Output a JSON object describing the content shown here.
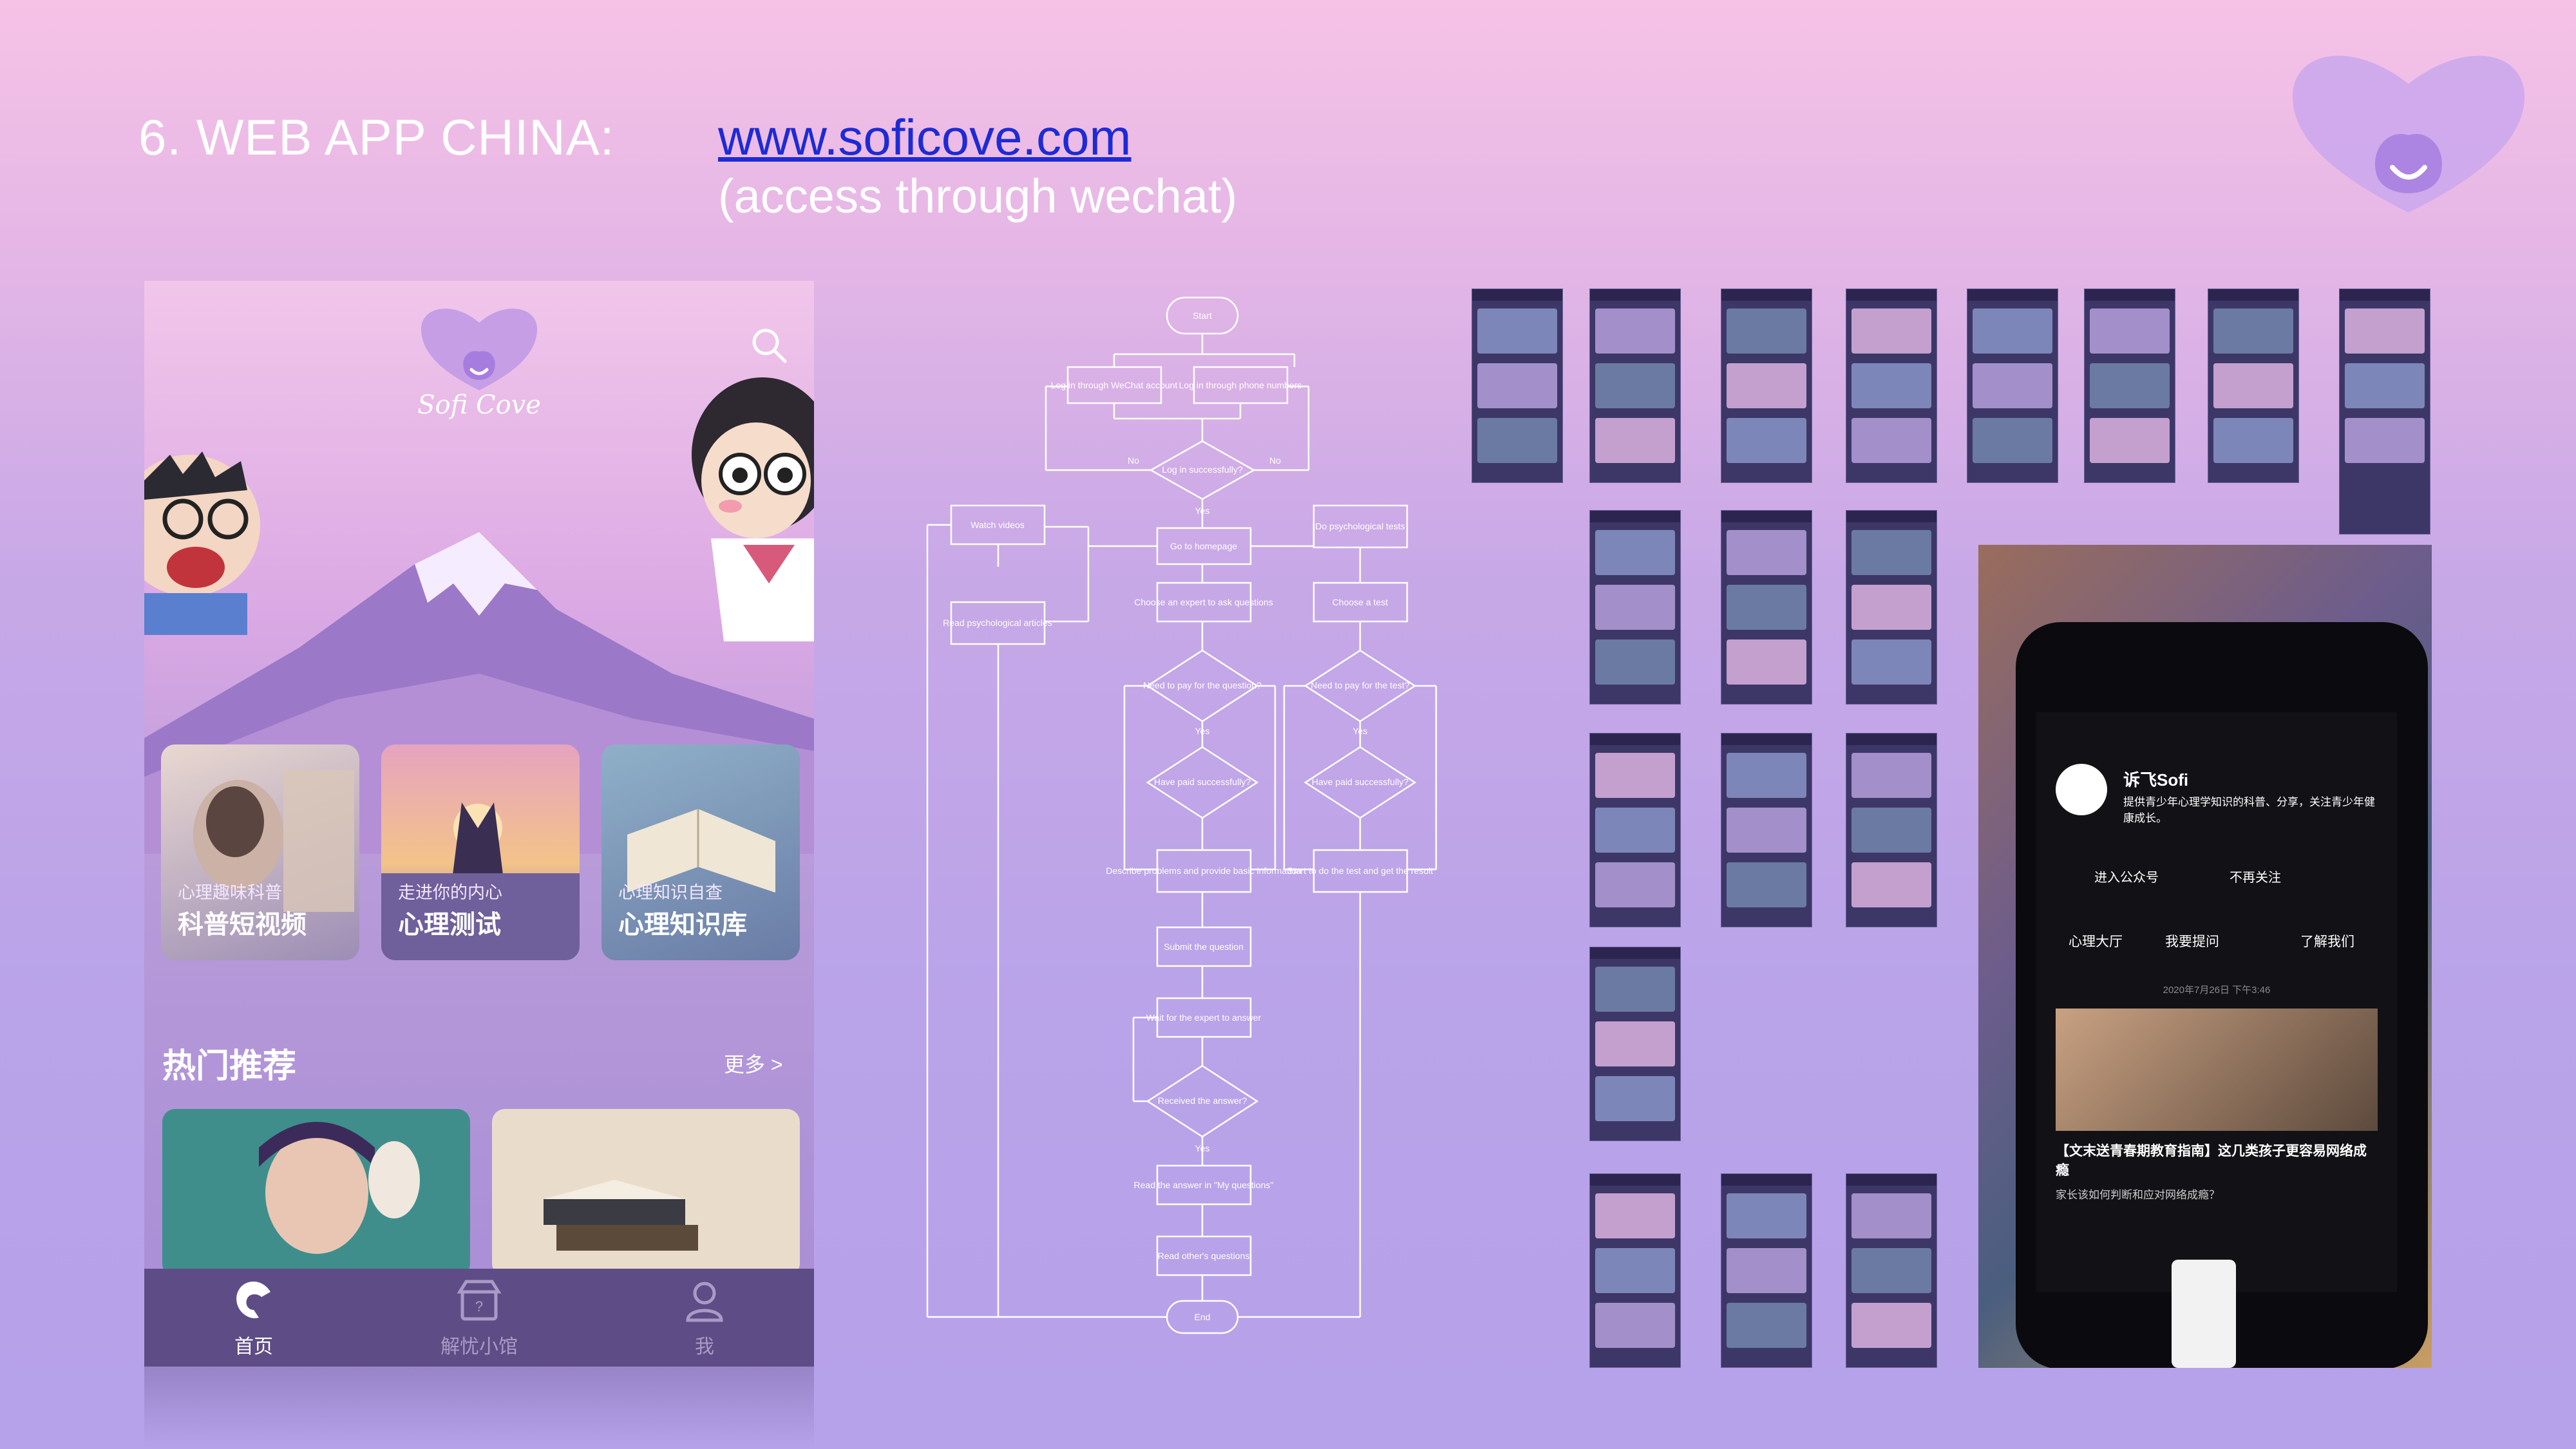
{
  "header": {
    "title": "6. WEB APP CHINA:",
    "url": "www.soficove.com",
    "subtitle": "(access through wechat)"
  },
  "phone": {
    "brand": "Sofi Cove",
    "cards": [
      {
        "subtitle": "心理趣味科普",
        "title": "科普短视频"
      },
      {
        "subtitle": "走进你的内心",
        "title": "心理测试"
      },
      {
        "subtitle": "心理知识自查",
        "title": "心理知识库"
      }
    ],
    "section_title": "热门推荐",
    "more_label": "更多 >",
    "tabs": [
      {
        "label": "首页",
        "icon": "home-icon",
        "active": true
      },
      {
        "label": "解忧小馆",
        "icon": "store-icon",
        "active": false
      },
      {
        "label": "我",
        "icon": "profile-icon",
        "active": false
      }
    ]
  },
  "flowchart": {
    "nodes": {
      "start": "Start",
      "login_wechat": "Log in through WeChat account",
      "login_phone": "Log in through phone numbers",
      "login_ok": "Log in successfully?",
      "watch_videos": "Watch videos",
      "homepage": "Go to homepage",
      "psych_tests": "Do psychological tests",
      "read_articles": "Read psychological articles",
      "choose_expert": "Choose an expert to ask questions",
      "choose_test": "Choose a test",
      "pay_question": "Need to pay for the question?",
      "pay_test": "Need to pay for the test?",
      "paid_q": "Have paid successfully?",
      "paid_t": "Have paid successfully?",
      "describe": "Describe problems and provide basic information",
      "start_test": "Start to do the test and get the result",
      "submit": "Submit the question",
      "wait": "Wait for the expert to answer",
      "received": "Received the answer?",
      "read_answer": "Read the answer in \"My questions\"",
      "read_others": "Read other's questions",
      "end": "End"
    },
    "yes": "Yes",
    "no": "No"
  },
  "photo": {
    "account_name": "诉飞Sofi",
    "account_desc": "提供青少年心理学知识的科普、分享，关注青少年健康成长。",
    "action_enter": "进入公众号",
    "action_unfollow": "不再关注",
    "menu": [
      "心理大厅",
      "我要提问",
      "了解我们"
    ],
    "date": "2020年7月26日 下午3:46",
    "headline": "【文末送青春期教育指南】这几类孩子更容易网络成瘾",
    "summary": "家长该如何判断和应对网络成瘾？"
  },
  "colors": {
    "link": "#1d2bd6",
    "tabbar": "#5e4c86",
    "accent": "#b6a2ea"
  }
}
